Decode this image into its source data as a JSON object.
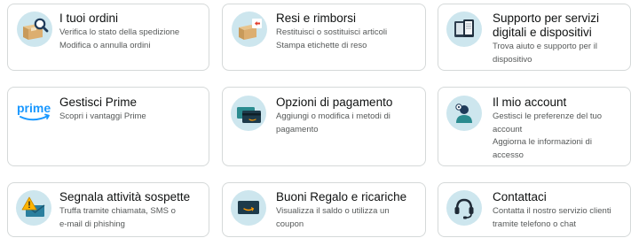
{
  "cards": [
    {
      "title": "I tuoi ordini",
      "desc": [
        "Verifica lo stato della spedizione",
        "Modifica o annulla ordini"
      ],
      "icon": "box-search-icon"
    },
    {
      "title": "Resi e rimborsi",
      "desc": [
        "Restituisci o sostituisci articoli",
        "Stampa etichette di reso"
      ],
      "icon": "return-box-icon"
    },
    {
      "title_lines": [
        "Supporto per servizi",
        "digitali e dispositivi"
      ],
      "desc": [
        "Trova aiuto e supporto per il",
        "dispositivo"
      ],
      "icon": "kindle-devices-icon"
    },
    {
      "title": "Gestisci Prime",
      "desc": [
        "Scopri i vantaggi Prime"
      ],
      "icon": "prime-logo-icon",
      "logo_text": "prime"
    },
    {
      "title": "Opzioni di pagamento",
      "desc": [
        "Aggiungi o modifica i metodi di",
        "pagamento"
      ],
      "icon": "payment-cards-icon"
    },
    {
      "title": "Il mio account",
      "desc": [
        "Gestisci le preferenze del tuo",
        "account",
        "Aggiorna le informazioni di",
        "accesso"
      ],
      "icon": "account-person-icon"
    },
    {
      "title": "Segnala attività sospette",
      "desc": [
        "Truffa tramite chiamata, SMS o",
        "e-mail di phishing"
      ],
      "icon": "warning-mail-icon"
    },
    {
      "title": "Buoni Regalo e ricariche",
      "desc": [
        "Visualizza il saldo o utilizza un",
        "coupon"
      ],
      "icon": "gift-card-icon"
    },
    {
      "title": "Contattaci",
      "desc": [
        "Contatta il nostro servizio clienti",
        "tramite telefono o chat"
      ],
      "icon": "headset-icon"
    }
  ],
  "colors": {
    "icon_bg": "#cde6ee",
    "border": "#d5d9d9",
    "prime_blue": "#1a98ff",
    "smile_orange": "#ff9900"
  }
}
